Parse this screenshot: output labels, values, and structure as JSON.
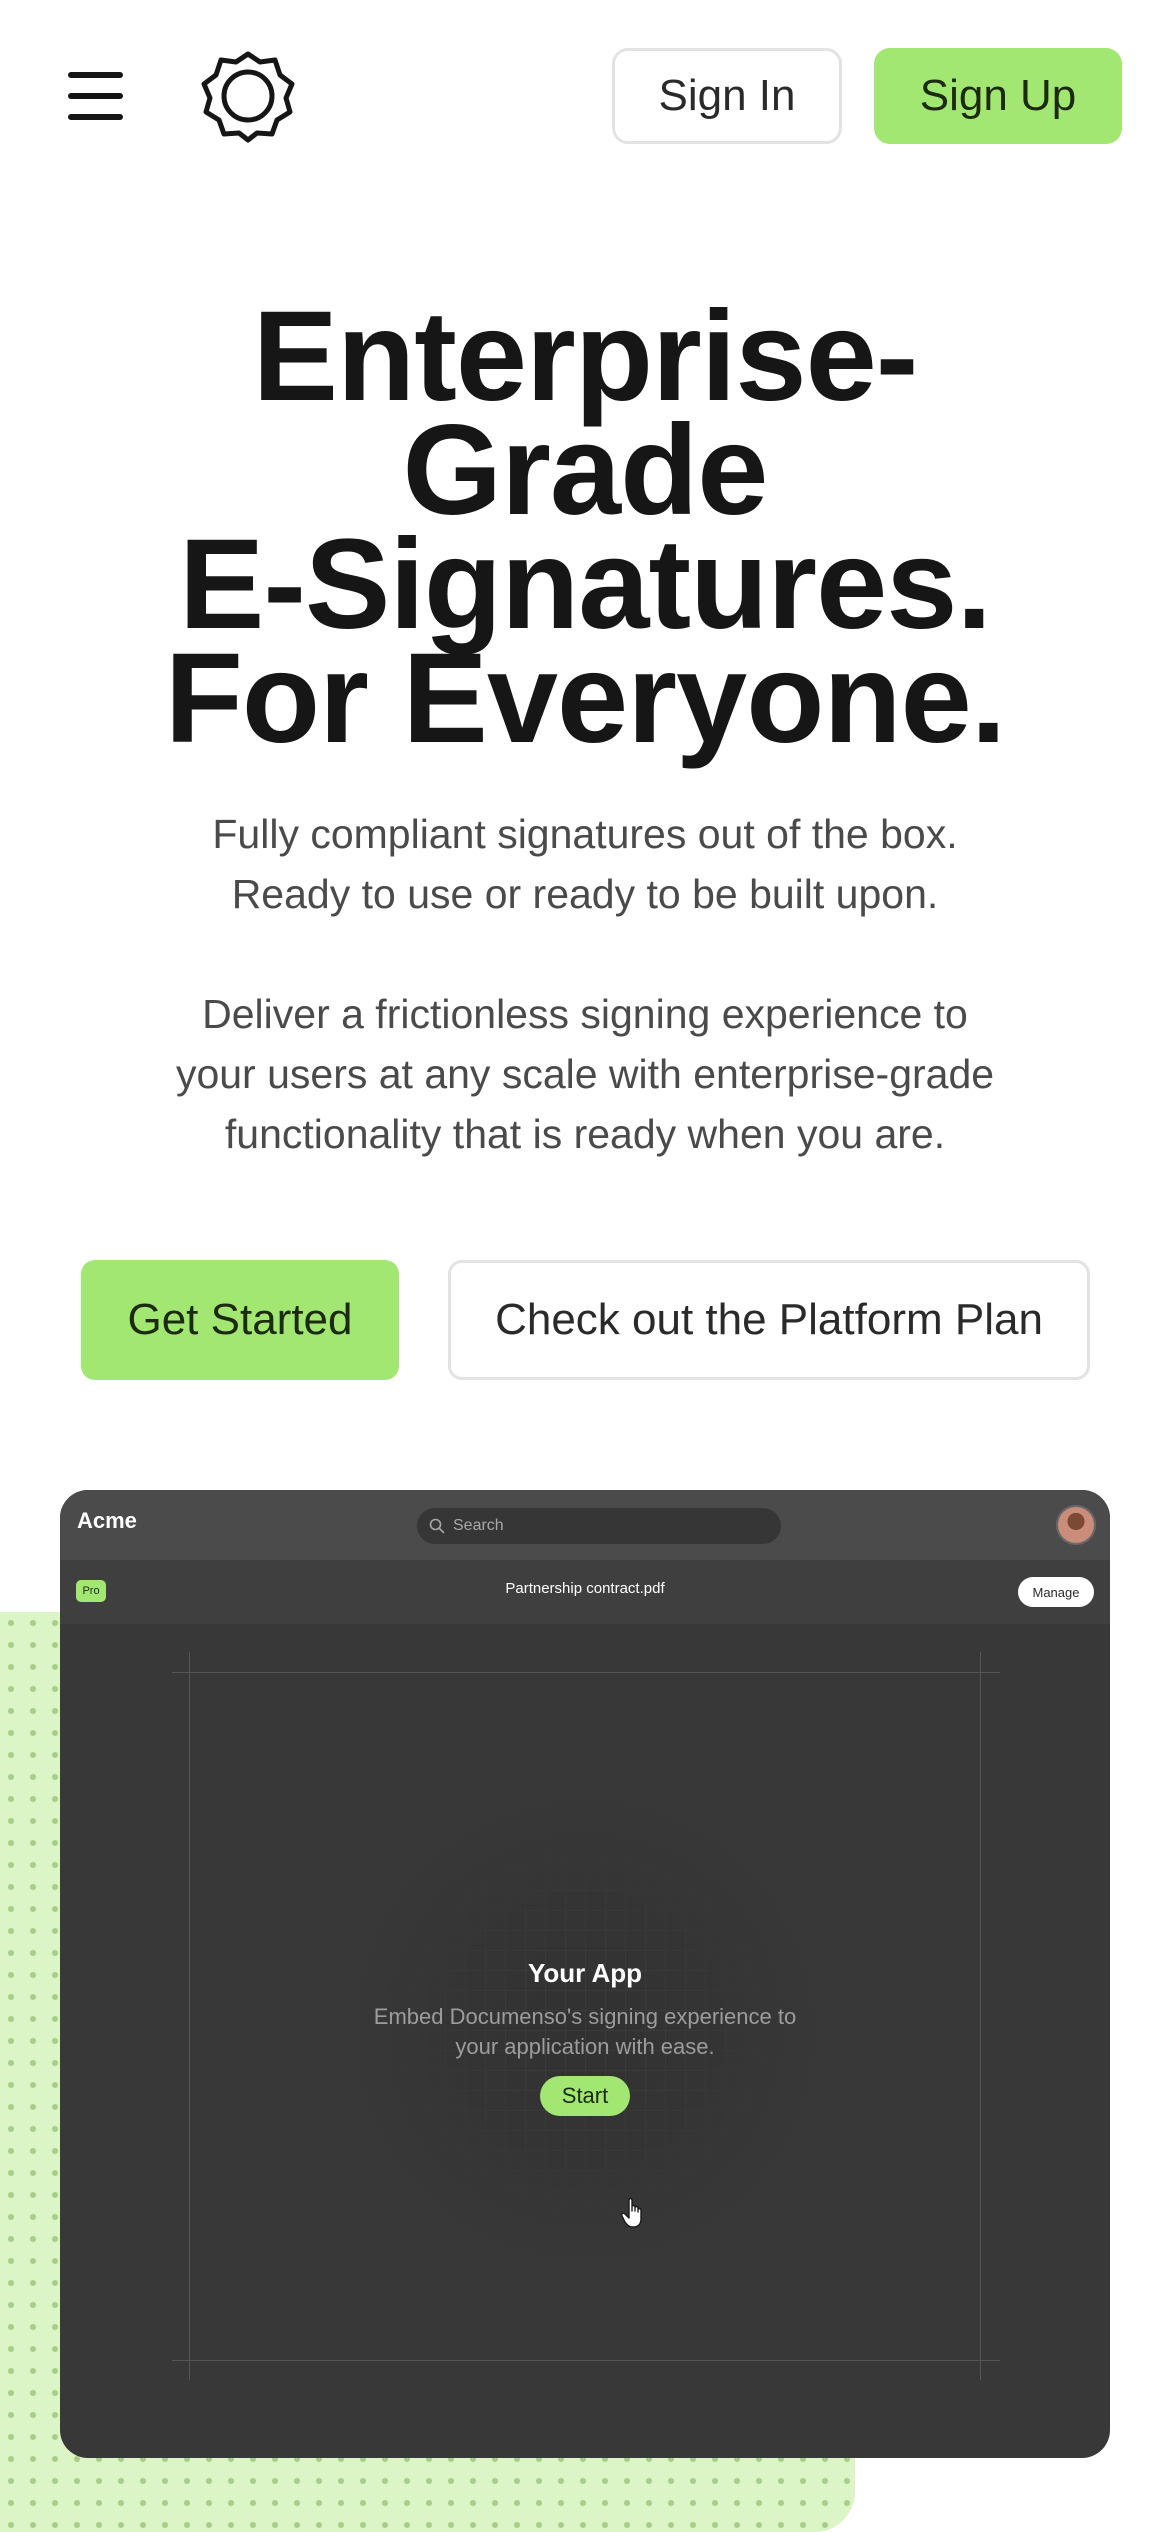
{
  "header": {
    "menu_icon": "hamburger-menu-icon",
    "logo_icon": "documenso-logo-icon",
    "signin_label": "Sign In",
    "signup_label": "Sign Up"
  },
  "hero": {
    "title_lines": [
      "Enterprise-",
      "Grade",
      "E-Signatures.",
      "For Everyone."
    ],
    "subtitle_lines": [
      "Fully compliant signatures out of the box.",
      "Ready to use or ready to be built upon."
    ],
    "description_lines": [
      "Deliver a frictionless signing experience to",
      "your users at any scale with enterprise-grade",
      "functionality that is ready when you are."
    ],
    "cta_primary": "Get Started",
    "cta_secondary": "Check out the Platform Plan"
  },
  "mockup": {
    "brand": "Acme",
    "search_placeholder": "Search",
    "search_icon": "search-icon",
    "avatar": "user-avatar",
    "badge": "Pro",
    "document_name": "Partnership contract.pdf",
    "manage_label": "Manage",
    "app_title": "Your App",
    "app_description_lines": [
      "Embed Documenso's signing experience to",
      "your application with ease."
    ],
    "start_label": "Start",
    "cursor_icon": "hand-pointer-icon"
  },
  "colors": {
    "accent": "#a2e771",
    "accent_light": "#dbf5c7",
    "mockup_bg": "#383838",
    "text_dark": "#161616"
  }
}
